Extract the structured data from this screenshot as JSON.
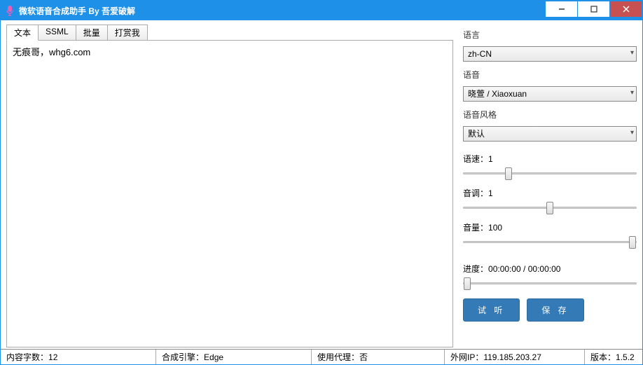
{
  "window": {
    "title": "微软语音合成助手 By 吾爱破解"
  },
  "tabs": [
    "文本",
    "SSML",
    "批量",
    "打赏我"
  ],
  "textarea": {
    "value": "无痕哥，whg6.com"
  },
  "right": {
    "language_label": "语言",
    "language_value": "zh-CN",
    "voice_label": "语音",
    "voice_value": "晓萱 / Xiaoxuan",
    "style_label": "语音风格",
    "style_value": "默认",
    "speed_label": "语速：",
    "speed_value": "1",
    "pitch_label": "音调：",
    "pitch_value": "1",
    "volume_label": "音量：",
    "volume_value": "100",
    "progress_label": "进度：",
    "progress_value": "00:00:00 / 00:00:00",
    "listen_btn": "试 听",
    "save_btn": "保 存"
  },
  "status": {
    "chars_label": "内容字数：",
    "chars_value": "12",
    "engine_label": "合成引擎：",
    "engine_value": "Edge",
    "proxy_label": "使用代理：",
    "proxy_value": "否",
    "ip_label": "外网IP：",
    "ip_value": "119.185.203.27",
    "version_label": "版本：",
    "version_value": "1.5.2"
  }
}
